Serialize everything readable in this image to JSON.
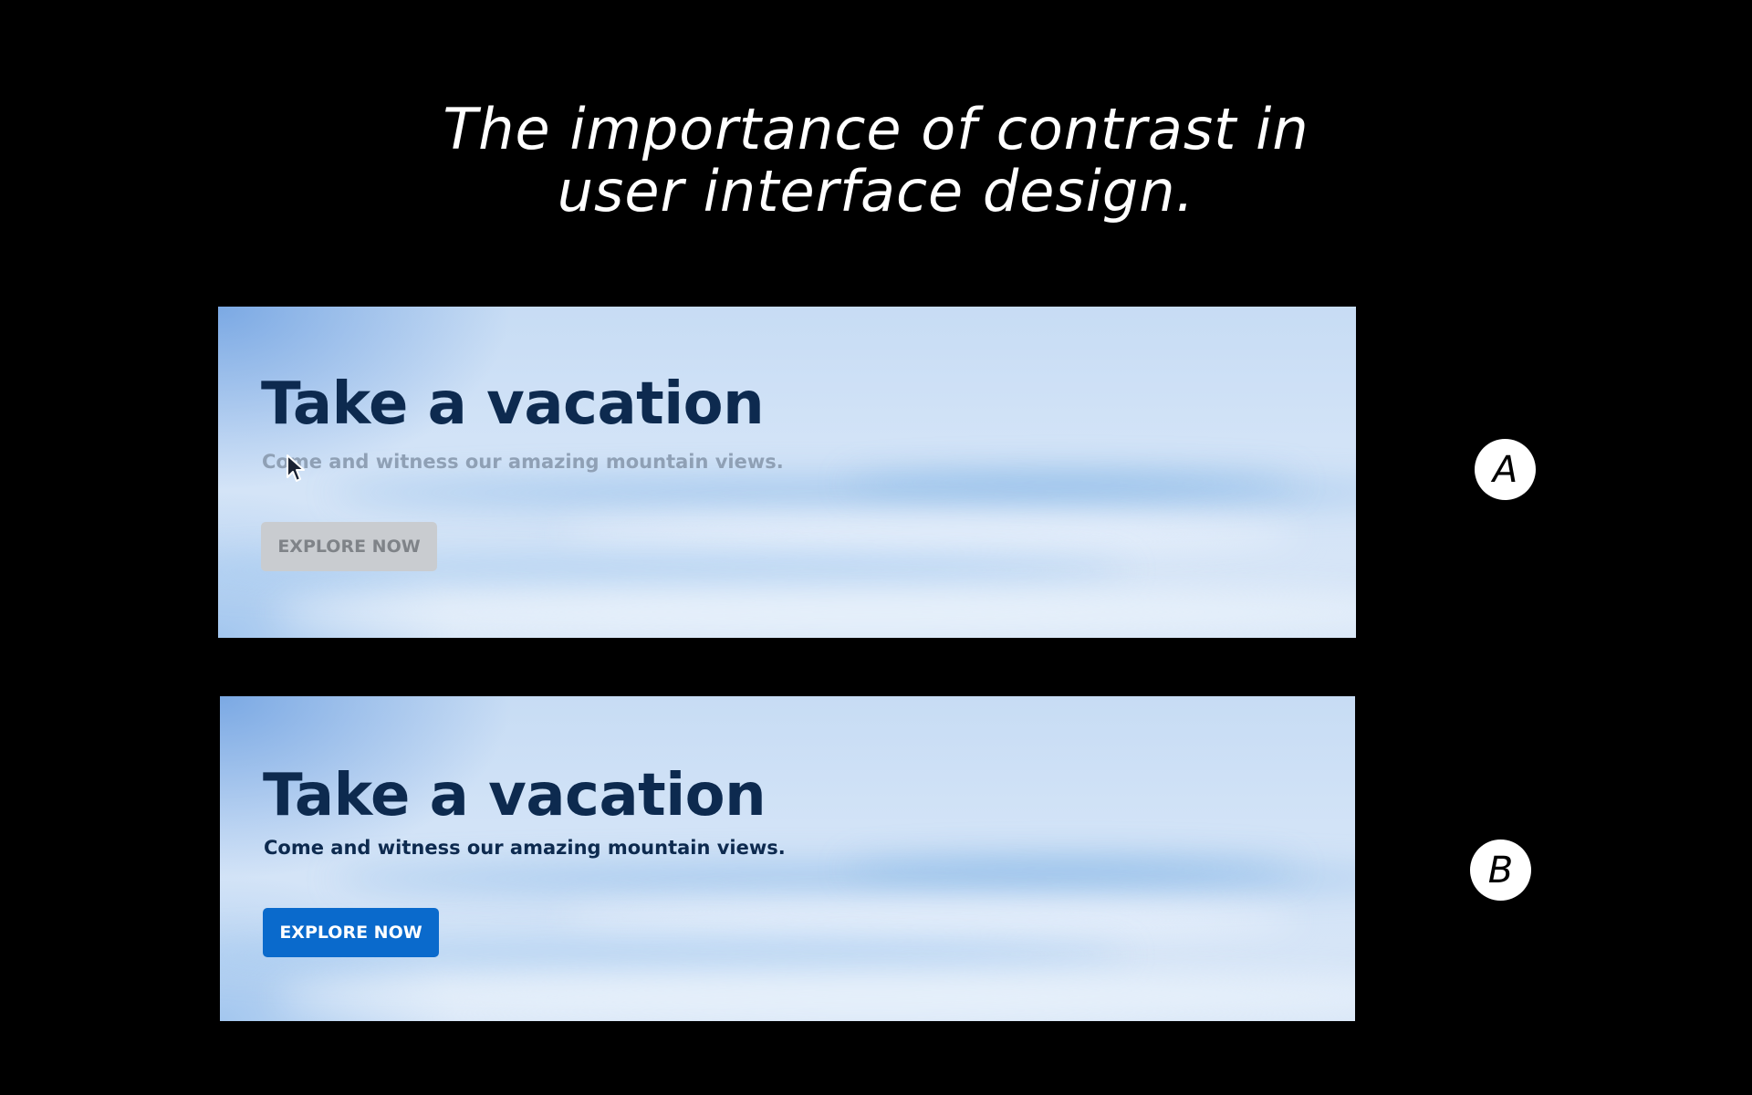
{
  "title": {
    "line1": "The importance of contrast in",
    "line2": "user interface design."
  },
  "banners": [
    {
      "label": "A",
      "headline": "Take a vacation",
      "subtitle": "Come and witness our amazing mountain views.",
      "button_label": "EXPLORE NOW"
    },
    {
      "label": "B",
      "headline": "Take a vacation",
      "subtitle": "Come and witness our amazing mountain views.",
      "button_label": "EXPLORE NOW"
    }
  ],
  "colors": {
    "background": "#000000",
    "headline": "#0d2a4f",
    "low_contrast_subtitle": "#8fa0b5",
    "low_contrast_button_bg": "#c9ccd0",
    "low_contrast_button_text": "#7f8388",
    "high_contrast_button_bg": "#0a6acc",
    "high_contrast_button_text": "#ffffff"
  },
  "icons": {
    "cursor": "mouse-pointer-icon"
  }
}
